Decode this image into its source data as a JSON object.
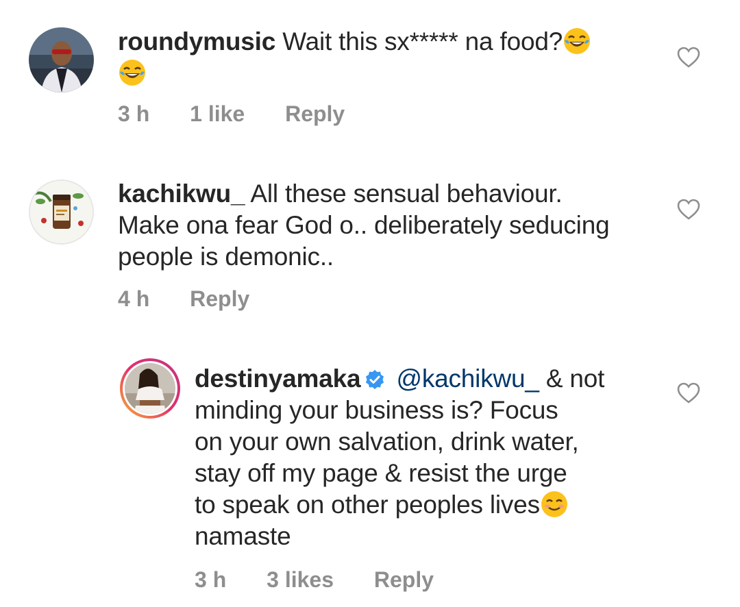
{
  "comments": [
    {
      "username": "roundymusic",
      "text": "Wait this sx***** na food?",
      "emoji": "😂",
      "emoji_trailing": "😂",
      "time": "3 h",
      "likes": "1 like",
      "reply": "Reply",
      "icons": {
        "like": "heart-icon",
        "emoji": "tears-of-joy-emoji"
      }
    },
    {
      "username": "kachikwu_",
      "text_line1": "All these sensual behaviour.",
      "text_line2": "Make ona fear God o.. deliberately seducing",
      "text_line3": "people is demonic..",
      "time": "4 h",
      "reply": "Reply",
      "icons": {
        "like": "heart-icon"
      }
    },
    {
      "username": "destinyamaka",
      "verified_icon": "verified-badge-icon",
      "mention": "@kachikwu_",
      "text_line1": "& not",
      "text_line2": "minding your business is? Focus",
      "text_line3": "on your own salvation, drink water,",
      "text_line4": "stay off my page & resist the urge",
      "text_line5": "to speak on other peoples lives",
      "text_line6": "namaste",
      "emoji": "☺️",
      "time": "3 h",
      "likes": "3 likes",
      "reply": "Reply",
      "icons": {
        "like": "heart-icon",
        "emoji": "smiling-face-emoji"
      }
    }
  ],
  "colors": {
    "text": "#262626",
    "meta": "#8e8e8e",
    "mention": "#00376b",
    "verified": "#3897f0",
    "heart": "#8e8e8e"
  }
}
